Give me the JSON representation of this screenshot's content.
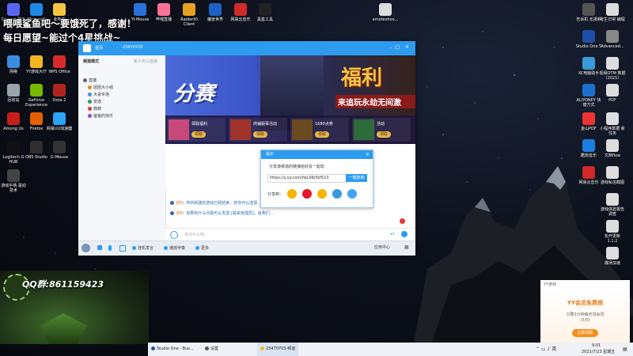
{
  "overlay": {
    "line1": "喂喂鲨鱼吧～要饿死了，感谢！",
    "line2": "每日愿望~能过个4星挑战~",
    "qq_group": "QQ群:861159423"
  },
  "desktop_left": [
    {
      "label": "Discord 聊天",
      "color": "#5865f2"
    },
    {
      "label": "Microsoft Edge",
      "color": "#1e88e5"
    },
    {
      "label": "此电脑",
      "color": "#f4c542"
    },
    {
      "label": "网络",
      "color": "#3b8de0"
    },
    {
      "label": "YY游戏大厅",
      "color": "#f3b623"
    },
    {
      "label": "WPS Office",
      "color": "#d92b2b"
    },
    {
      "label": "回收站",
      "color": "#9aa4ae"
    },
    {
      "label": "GeForce Experience",
      "color": "#76b900"
    },
    {
      "label": "Dota 2",
      "color": "#b0261d"
    },
    {
      "label": "Among Us",
      "color": "#c81e1e"
    },
    {
      "label": "Firefox",
      "color": "#e66000"
    },
    {
      "label": "网易UU加速器",
      "color": "#2aa4f4"
    },
    {
      "label": "Logitech G HUB",
      "color": "#111"
    },
    {
      "label": "OBS Studio",
      "color": "#302e31"
    },
    {
      "label": "G-Mouse",
      "color": "#333"
    },
    {
      "label": "游戏手柄 驱动技术",
      "color": "#444"
    }
  ],
  "desktop_top": [
    {
      "label": "YI-Mouse",
      "color": "#2a70d8"
    },
    {
      "label": "哔哩直播",
      "color": "#fb7299"
    },
    {
      "label": "RaiderIO Client",
      "color": "#e8a020"
    },
    {
      "label": "魔兽世界",
      "color": "#1c62c4"
    },
    {
      "label": "网易云音乐",
      "color": "#d22a2a"
    },
    {
      "label": "黑盒工具",
      "color": "#222"
    },
    {
      "label": "emoteshoo...",
      "color": "#ddd"
    }
  ],
  "desktop_right": [
    {
      "label": "告诉机 长视频",
      "color": "#555"
    },
    {
      "label": "考生日常 编程",
      "color": "#ddd"
    },
    {
      "label": "Studio One 5",
      "color": "#1d4fa8"
    },
    {
      "label": "Advanced...",
      "color": "#888"
    },
    {
      "label": "XC电脑助手",
      "color": "#3a9ad9"
    },
    {
      "label": "视频OTM 数据（2021）",
      "color": "#ddd"
    },
    {
      "label": "ALIYONEY 快捷方式",
      "color": "#1d6fd0"
    },
    {
      "label": "PDF",
      "color": "#ddd"
    },
    {
      "label": "金山PDF",
      "color": "#e33"
    },
    {
      "label": "小程序数据 新任务",
      "color": "#ddd"
    },
    {
      "label": "酷狗音乐",
      "color": "#1a7fe0"
    },
    {
      "label": "文档flow",
      "color": "#ddd"
    },
    {
      "label": "网易云音乐",
      "color": "#d22a2a"
    },
    {
      "label": "游戏私信截图",
      "color": "#ddd"
    },
    {
      "label": "游戏体验报告 调查",
      "color": "#ddd"
    },
    {
      "label": "松开更新 1.1.2",
      "color": "#ddd"
    },
    {
      "label": "爆场加速",
      "color": "#ddd"
    }
  ],
  "qq_window": {
    "title": "23470703",
    "tab": "首页",
    "sidebar_header": "频道模式",
    "sidebar_sub": "新人可以直接",
    "channels": [
      {
        "label": "直播",
        "color": "#666"
      },
      {
        "label": "团团大小组",
        "color": "#e38d00"
      },
      {
        "label": "大哥专场",
        "color": "#4a8de0"
      },
      {
        "label": "安逸",
        "color": "#2a9d4a"
      },
      {
        "label": "莽莽",
        "color": "#d93a3a"
      },
      {
        "label": "爸爸的快乐",
        "color": "#9a47c8"
      }
    ],
    "banner_left_text": "分赛",
    "banner_right_big": "福利",
    "banner_right_sub": "来追玩永劫无间激",
    "cards": [
      {
        "title": "领取福利",
        "btn": "领取"
      },
      {
        "title": "商铺服事活动",
        "btn": "领取"
      },
      {
        "title": "1680点券",
        "btn": "领取"
      },
      {
        "title": "活动",
        "btn": "领取"
      }
    ],
    "messages": [
      {
        "prefix": "通知:",
        "text": "你的新建的游戏已经结束，若你可以选择 ..."
      },
      {
        "prefix": "通知:",
        "text": "如果有什么问题可以发送 [联系管理员]，给我们..."
      }
    ],
    "input_placeholder": "说点什么吧...",
    "bottom_items": [
      {
        "label": "挂机发言"
      },
      {
        "label": "播放伴奏"
      },
      {
        "label": "更多"
      }
    ],
    "app_center": "应用中心"
  },
  "share_popup": {
    "title": "提示",
    "desc": "分享该频道的链接给好友一起玩",
    "url": "https://y.yy.com/fwL9lb5kf513",
    "copy_btn": "一键复制",
    "share_label": "分享到：",
    "targets": [
      {
        "name": "qq-share-icon",
        "color": "#f4b400"
      },
      {
        "name": "weibo-share-icon",
        "color": "#e6162d"
      },
      {
        "name": "qzone-share-icon",
        "color": "#f8b300"
      },
      {
        "name": "tencent-share-icon",
        "color": "#3a9ad9"
      },
      {
        "name": "friends-share-icon",
        "color": "#42a5f5"
      }
    ]
  },
  "notification": {
    "app": "YY游戏",
    "title": "YY会员免费领",
    "line": "只要3分钟每天领会员",
    "progress": "(5/5)",
    "btn": "立即领取"
  },
  "taskbar": {
    "items": [
      {
        "label": "Studio One - Bus..."
      },
      {
        "label": "设置"
      },
      {
        "label": "23470703-频道"
      }
    ],
    "time": "9:01",
    "date": "2021/7/23 星期五"
  }
}
